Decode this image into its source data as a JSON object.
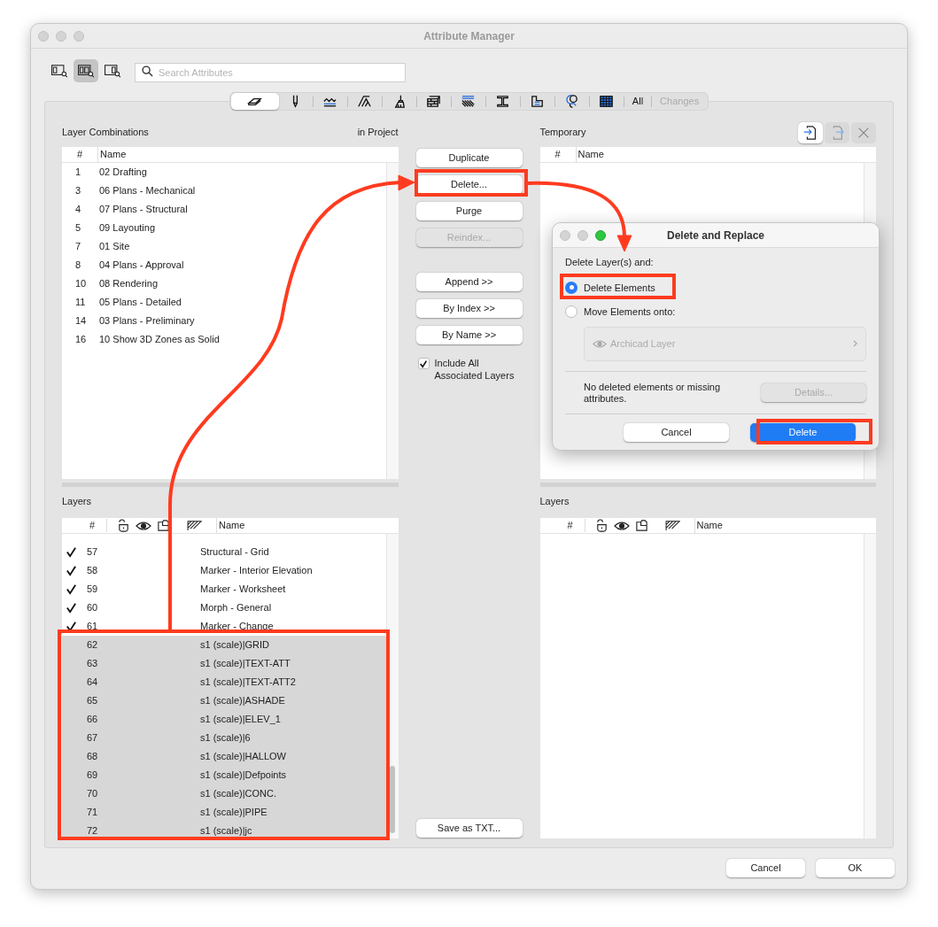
{
  "window": {
    "title": "Attribute Manager"
  },
  "view_buttons": [
    {
      "selected": false
    },
    {
      "selected": true
    },
    {
      "selected": false
    }
  ],
  "search": {
    "placeholder": "Search Attributes"
  },
  "tabs": [
    {
      "kind": "icon",
      "selected": true,
      "disabled": false
    },
    {
      "kind": "icon",
      "selected": false,
      "disabled": false
    },
    {
      "kind": "icon",
      "selected": false,
      "disabled": false
    },
    {
      "kind": "icon",
      "selected": false,
      "disabled": false
    },
    {
      "kind": "icon",
      "selected": false,
      "disabled": false
    },
    {
      "kind": "icon",
      "selected": false,
      "disabled": false
    },
    {
      "kind": "icon",
      "selected": false,
      "disabled": false
    },
    {
      "kind": "icon",
      "selected": false,
      "disabled": false
    },
    {
      "kind": "icon",
      "selected": false,
      "disabled": false
    },
    {
      "kind": "icon",
      "selected": false,
      "disabled": false
    },
    {
      "kind": "icon",
      "selected": false,
      "disabled": false
    },
    {
      "kind": "text",
      "label": "All",
      "selected": false,
      "disabled": false
    },
    {
      "kind": "text",
      "label": "Changes",
      "selected": false,
      "disabled": true
    }
  ],
  "left": {
    "combinations": {
      "title": "Layer Combinations",
      "scope": "in Project",
      "columns": [
        "#",
        "Name"
      ],
      "rows": [
        {
          "number": "1",
          "name": "02 Drafting"
        },
        {
          "number": "3",
          "name": "06 Plans - Mechanical"
        },
        {
          "number": "4",
          "name": "07 Plans - Structural"
        },
        {
          "number": "5",
          "name": "09 Layouting"
        },
        {
          "number": "7",
          "name": "01 Site"
        },
        {
          "number": "8",
          "name": "04 Plans - Approval"
        },
        {
          "number": "10",
          "name": "08 Rendering"
        },
        {
          "number": "11",
          "name": "05 Plans - Detailed"
        },
        {
          "number": "14",
          "name": "03 Plans - Preliminary"
        },
        {
          "number": "16",
          "name": "10 Show 3D Zones as Solid"
        }
      ]
    },
    "layers": {
      "title": "Layers",
      "columns": [
        "#",
        "Name"
      ],
      "rows": [
        {
          "checked": true,
          "number": "57",
          "name": "Structural - Grid",
          "selected": false
        },
        {
          "checked": true,
          "number": "58",
          "name": "Marker - Interior Elevation",
          "selected": false
        },
        {
          "checked": true,
          "number": "59",
          "name": "Marker - Worksheet",
          "selected": false
        },
        {
          "checked": true,
          "number": "60",
          "name": "Morph - General",
          "selected": false
        },
        {
          "checked": true,
          "number": "61",
          "name": "Marker - Change",
          "selected": false
        },
        {
          "checked": false,
          "number": "62",
          "name": "s1 (scale)|GRID",
          "selected": true
        },
        {
          "checked": false,
          "number": "63",
          "name": "s1 (scale)|TEXT-ATT",
          "selected": true
        },
        {
          "checked": false,
          "number": "64",
          "name": "s1 (scale)|TEXT-ATT2",
          "selected": true
        },
        {
          "checked": false,
          "number": "65",
          "name": "s1 (scale)|ASHADE",
          "selected": true
        },
        {
          "checked": false,
          "number": "66",
          "name": "s1 (scale)|ELEV_1",
          "selected": true
        },
        {
          "checked": false,
          "number": "67",
          "name": "s1 (scale)|6",
          "selected": true
        },
        {
          "checked": false,
          "number": "68",
          "name": "s1 (scale)|HALLOW",
          "selected": true
        },
        {
          "checked": false,
          "number": "69",
          "name": "s1 (scale)|Defpoints",
          "selected": true
        },
        {
          "checked": false,
          "number": "70",
          "name": "s1 (scale)|CONC.",
          "selected": true
        },
        {
          "checked": false,
          "number": "71",
          "name": "s1 (scale)|PIPE",
          "selected": true
        },
        {
          "checked": false,
          "number": "72",
          "name": "s1 (scale)|jc",
          "selected": true
        }
      ]
    }
  },
  "middle": {
    "buttons": [
      {
        "label": "Duplicate",
        "disabled": false
      },
      {
        "label": "Delete...",
        "disabled": false
      },
      {
        "label": "Purge",
        "disabled": false
      },
      {
        "label": "Reindex...",
        "disabled": true
      }
    ],
    "transfer_buttons": [
      {
        "label": "Append >>",
        "disabled": false
      },
      {
        "label": "By Index >>",
        "disabled": false
      },
      {
        "label": "By Name >>",
        "disabled": false
      }
    ],
    "include": {
      "label": "Include All Associated Layers",
      "checked": true
    },
    "save": "Save as TXT..."
  },
  "right": {
    "temporary": {
      "title": "Temporary",
      "columns": [
        "#",
        "Name"
      ]
    },
    "layers": {
      "title": "Layers",
      "columns": [
        "#",
        "Name"
      ]
    }
  },
  "footer": {
    "buttons": [
      "Cancel",
      "OK"
    ]
  },
  "dialog": {
    "title": "Delete and Replace",
    "prompt": "Delete Layer(s) and:",
    "options": [
      {
        "label": "Delete Elements",
        "selected": true
      },
      {
        "label": "Move Elements onto:",
        "selected": false
      }
    ],
    "target": {
      "value": "Archicad Layer",
      "disabled": true
    },
    "info": "No deleted elements or missing attributes.",
    "details": {
      "label": "Details...",
      "disabled": true
    },
    "buttons": [
      {
        "label": "Cancel",
        "default": false
      },
      {
        "label": "Delete",
        "default": true
      }
    ]
  }
}
